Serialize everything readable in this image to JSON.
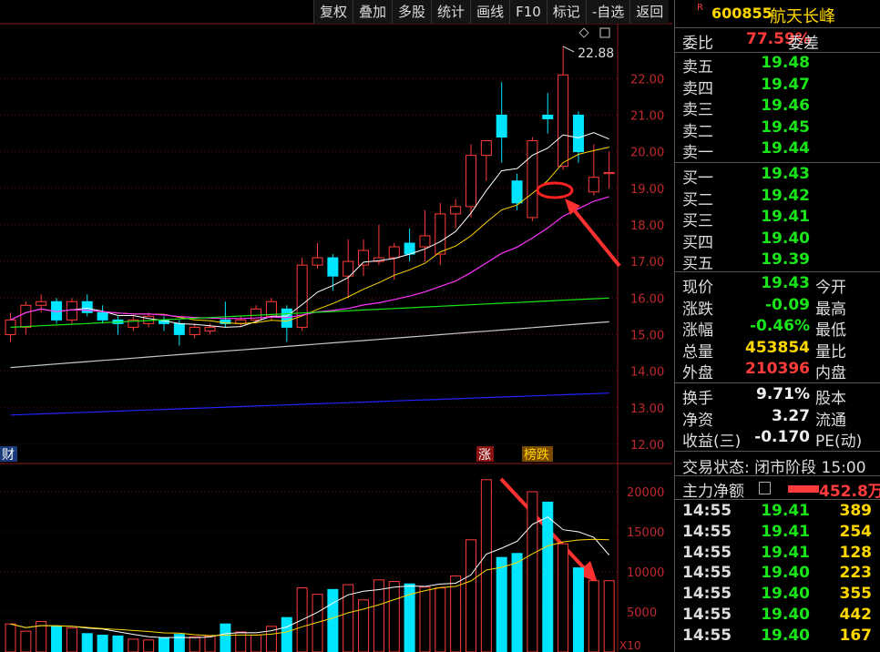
{
  "toolbar": [
    "复权",
    "叠加",
    "多股",
    "统计",
    "画线",
    "F10",
    "标记",
    "-自选",
    "返回"
  ],
  "stock": {
    "badge": "R",
    "code": "600855",
    "name": "航天长峰"
  },
  "commission": {
    "ratio_label": "委比",
    "ratio": "77.59%",
    "diff_label": "委差"
  },
  "sell_orders": [
    {
      "label": "卖五",
      "price": "19.48"
    },
    {
      "label": "卖四",
      "price": "19.47"
    },
    {
      "label": "卖三",
      "price": "19.46"
    },
    {
      "label": "卖二",
      "price": "19.45"
    },
    {
      "label": "卖一",
      "price": "19.44"
    }
  ],
  "buy_orders": [
    {
      "label": "买一",
      "price": "19.43"
    },
    {
      "label": "买二",
      "price": "19.42"
    },
    {
      "label": "买三",
      "price": "19.41"
    },
    {
      "label": "买四",
      "price": "19.40"
    },
    {
      "label": "买五",
      "price": "19.39"
    }
  ],
  "quote": [
    {
      "label": "现价",
      "value": "19.43",
      "color": "#19e619",
      "label2": "今开"
    },
    {
      "label": "涨跌",
      "value": "-0.09",
      "color": "#19e619",
      "label2": "最高"
    },
    {
      "label": "涨幅",
      "value": "-0.46%",
      "color": "#19e619",
      "label2": "最低"
    },
    {
      "label": "总量",
      "value": "453854",
      "color": "#ffd700",
      "label2": "量比"
    },
    {
      "label": "外盘",
      "value": "210396",
      "color": "#ff3b3b",
      "label2": "内盘"
    }
  ],
  "finance": [
    {
      "label": "换手",
      "value": "9.71%",
      "label2": "股本"
    },
    {
      "label": "净资",
      "value": "3.27",
      "label2": "流通"
    },
    {
      "label": "收益(三)",
      "value": "-0.170",
      "label2": "PE(动)"
    }
  ],
  "trade_status": "交易状态: 闭市阶段 15:00",
  "main_flow": {
    "label": "主力净额",
    "value": "452.8万"
  },
  "ticks": [
    {
      "time": "14:55",
      "price": "19.41",
      "vol": "389",
      "color": "#ffd700"
    },
    {
      "time": "14:55",
      "price": "19.41",
      "vol": "254",
      "color": "#ffd700"
    },
    {
      "time": "14:55",
      "price": "19.41",
      "vol": "128",
      "color": "#ffd700"
    },
    {
      "time": "14:55",
      "price": "19.40",
      "vol": "223",
      "color": "#ffd700"
    },
    {
      "time": "14:55",
      "price": "19.40",
      "vol": "355",
      "color": "#ffd700"
    },
    {
      "time": "14:55",
      "price": "19.40",
      "vol": "442",
      "color": "#ffd700"
    },
    {
      "time": "14:55",
      "price": "19.40",
      "vol": "167",
      "color": "#ffd700"
    }
  ],
  "chart_labels": {
    "high_marker": "22.88",
    "tag_zhang": "涨",
    "tag_bang": "榜跌",
    "tag_left": "财",
    "vol_unit": "X10"
  },
  "colors": {
    "up": "#ff3b3b",
    "down": "#00e5ff",
    "ma5": "#ffffff",
    "ma10": "#ffd700",
    "ma20": "#ff33ff",
    "ma60": "#19e619",
    "ma120": "#c8c8c8",
    "ma250": "#2222ff"
  },
  "chart_data": [
    {
      "type": "candlestick",
      "y_ticks": [
        12,
        13,
        14,
        15,
        16,
        17,
        18,
        19,
        20,
        21,
        22
      ],
      "ylim": [
        11.5,
        23.5
      ],
      "candles": [
        {
          "o": 15.0,
          "h": 15.6,
          "l": 14.8,
          "c": 15.4
        },
        {
          "o": 15.2,
          "h": 15.9,
          "l": 15.0,
          "c": 15.8
        },
        {
          "o": 15.8,
          "h": 16.1,
          "l": 15.6,
          "c": 15.9
        },
        {
          "o": 15.9,
          "h": 16.0,
          "l": 15.3,
          "c": 15.4
        },
        {
          "o": 15.4,
          "h": 16.0,
          "l": 15.3,
          "c": 15.9
        },
        {
          "o": 15.9,
          "h": 16.1,
          "l": 15.5,
          "c": 15.6
        },
        {
          "o": 15.6,
          "h": 15.8,
          "l": 15.3,
          "c": 15.4
        },
        {
          "o": 15.4,
          "h": 15.5,
          "l": 15.0,
          "c": 15.3
        },
        {
          "o": 15.2,
          "h": 15.5,
          "l": 15.1,
          "c": 15.4
        },
        {
          "o": 15.3,
          "h": 15.6,
          "l": 15.2,
          "c": 15.5
        },
        {
          "o": 15.4,
          "h": 15.5,
          "l": 15.1,
          "c": 15.3
        },
        {
          "o": 15.3,
          "h": 15.4,
          "l": 14.7,
          "c": 15.0
        },
        {
          "o": 15.0,
          "h": 15.3,
          "l": 14.9,
          "c": 15.2
        },
        {
          "o": 15.1,
          "h": 15.3,
          "l": 15.0,
          "c": 15.2
        },
        {
          "o": 15.4,
          "h": 15.9,
          "l": 15.2,
          "c": 15.3
        },
        {
          "o": 15.3,
          "h": 15.5,
          "l": 15.2,
          "c": 15.4
        },
        {
          "o": 15.4,
          "h": 15.8,
          "l": 15.3,
          "c": 15.7
        },
        {
          "o": 15.5,
          "h": 16.0,
          "l": 15.4,
          "c": 15.9
        },
        {
          "o": 15.7,
          "h": 15.8,
          "l": 14.8,
          "c": 15.2
        },
        {
          "o": 15.2,
          "h": 17.1,
          "l": 15.1,
          "c": 16.9
        },
        {
          "o": 16.9,
          "h": 17.5,
          "l": 16.8,
          "c": 17.1
        },
        {
          "o": 17.1,
          "h": 17.2,
          "l": 16.2,
          "c": 16.6
        },
        {
          "o": 16.6,
          "h": 17.6,
          "l": 16.0,
          "c": 17.0
        },
        {
          "o": 16.9,
          "h": 17.6,
          "l": 16.6,
          "c": 17.3
        },
        {
          "o": 17.0,
          "h": 18.0,
          "l": 16.9,
          "c": 17.1
        },
        {
          "o": 17.1,
          "h": 17.5,
          "l": 16.5,
          "c": 17.4
        },
        {
          "o": 17.5,
          "h": 17.9,
          "l": 17.0,
          "c": 17.2
        },
        {
          "o": 17.4,
          "h": 18.4,
          "l": 17.0,
          "c": 17.7
        },
        {
          "o": 17.2,
          "h": 18.6,
          "l": 16.9,
          "c": 18.3
        },
        {
          "o": 18.3,
          "h": 18.7,
          "l": 17.9,
          "c": 18.5
        },
        {
          "o": 18.5,
          "h": 20.2,
          "l": 18.2,
          "c": 19.9
        },
        {
          "o": 19.9,
          "h": 20.3,
          "l": 19.2,
          "c": 20.3
        },
        {
          "o": 21.0,
          "h": 21.9,
          "l": 19.7,
          "c": 20.4
        },
        {
          "o": 19.2,
          "h": 19.4,
          "l": 18.4,
          "c": 18.6
        },
        {
          "o": 18.2,
          "h": 20.4,
          "l": 18.1,
          "c": 20.3
        },
        {
          "o": 21.0,
          "h": 21.6,
          "l": 20.5,
          "c": 20.9
        },
        {
          "o": 19.6,
          "h": 22.88,
          "l": 19.5,
          "c": 22.1
        },
        {
          "o": 21.0,
          "h": 21.1,
          "l": 19.7,
          "c": 20.0
        },
        {
          "o": 18.9,
          "h": 20.2,
          "l": 18.8,
          "c": 19.3
        },
        {
          "o": 19.4,
          "h": 20.0,
          "l": 19.0,
          "c": 19.43
        }
      ]
    },
    {
      "type": "bar",
      "y_ticks": [
        5000,
        10000,
        15000,
        20000
      ],
      "ylim": [
        0,
        22500
      ],
      "values": [
        3500,
        2600,
        3800,
        3200,
        3000,
        2300,
        2100,
        2000,
        1600,
        1500,
        1800,
        2200,
        1900,
        2000,
        3500,
        2500,
        2100,
        3200,
        4300,
        8000,
        7200,
        7800,
        8400,
        6500,
        9000,
        8800,
        8500,
        8100,
        8000,
        9500,
        14000,
        21500,
        11800,
        12300,
        20000,
        18700,
        13500,
        10500,
        8900,
        8900
      ],
      "ma_lines": [
        "white",
        "yellow"
      ]
    }
  ]
}
